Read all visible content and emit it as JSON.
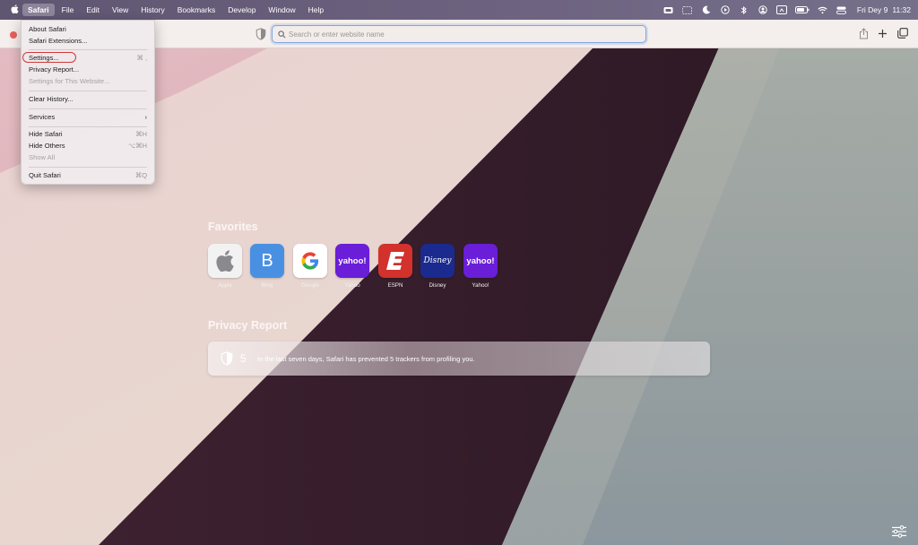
{
  "menubar": {
    "apple_icon": "apple-logo-icon",
    "items": [
      {
        "label": "Safari",
        "active": true
      },
      {
        "label": "File"
      },
      {
        "label": "Edit"
      },
      {
        "label": "View"
      },
      {
        "label": "History"
      },
      {
        "label": "Bookmarks"
      },
      {
        "label": "Develop"
      },
      {
        "label": "Window"
      },
      {
        "label": "Help"
      }
    ],
    "status_icons": [
      "stage-manager-icon",
      "screen-icon",
      "moon-icon",
      "play-icon",
      "bluetooth-icon",
      "account-icon",
      "display-icon",
      "battery-icon",
      "wifi-icon",
      "control-center-icon"
    ],
    "clock_date": "Fri Dey 9",
    "clock_time": "11:32"
  },
  "toolbar": {
    "url_placeholder": "Search or enter website name",
    "share_icon": "share-icon",
    "new_tab_icon": "plus-icon",
    "tabs_overview_icon": "tabs-overview-icon"
  },
  "safari_menu": {
    "about": "About Safari",
    "extensions": "Safari Extensions...",
    "settings": "Settings...",
    "settings_shortcut": "⌘ ,",
    "privacy_report": "Privacy Report...",
    "settings_website": "Settings for This Website...",
    "clear_history": "Clear History...",
    "services": "Services",
    "hide_safari": "Hide Safari",
    "hide_safari_shortcut": "⌘H",
    "hide_others": "Hide Others",
    "hide_others_shortcut": "⌥⌘H",
    "show_all": "Show All",
    "quit": "Quit Safari",
    "quit_shortcut": "⌘Q"
  },
  "favorites": {
    "title": "Favorites",
    "items": [
      {
        "label": "Apple",
        "tile": "apple-logo",
        "color": "#ffffff"
      },
      {
        "label": "Bing",
        "tile": "B",
        "color": "#4a90e2"
      },
      {
        "label": "Google",
        "tile": "google-g",
        "color": "#ffffff"
      },
      {
        "label": "Yahoo",
        "tile": "yahoo!",
        "color": "#6a1ed8"
      },
      {
        "label": "ESPN",
        "tile": "E",
        "color": "#d2312c"
      },
      {
        "label": "Disney",
        "tile": "Disney",
        "color": "#1b2a8f"
      },
      {
        "label": "Yahoo!",
        "tile": "yahoo!",
        "color": "#6a1ed8"
      }
    ]
  },
  "privacy_report": {
    "title": "Privacy Report",
    "count": "5",
    "text": "In the last seven days, Safari has prevented 5 trackers from profiling you."
  },
  "colors": {
    "accent_ring": "#d0383a",
    "close_button": "#ec5e58",
    "urlbar_focus": "#7fa5dd"
  }
}
